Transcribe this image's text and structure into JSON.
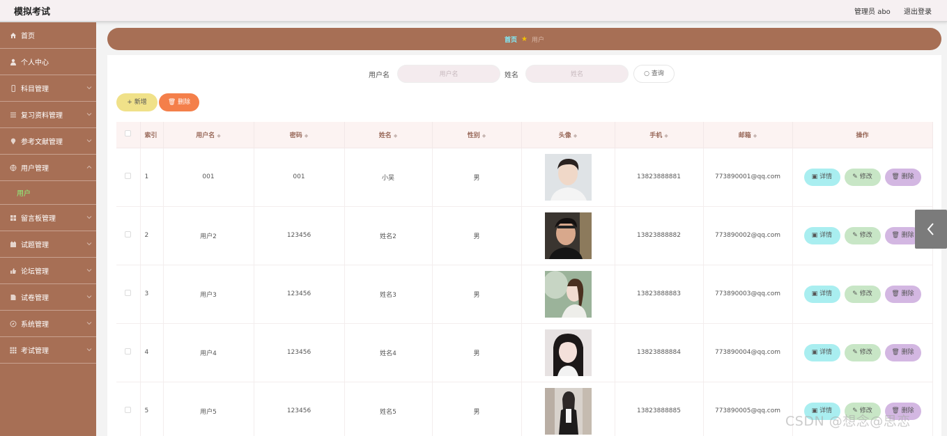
{
  "app": {
    "title": "模拟考试"
  },
  "header": {
    "user_label": "管理员 abo",
    "logout_label": "退出登录"
  },
  "sidebar": {
    "items": [
      {
        "label": "首页",
        "icon": "home-icon"
      },
      {
        "label": "个人中心",
        "icon": "user-icon"
      },
      {
        "label": "科目管理",
        "icon": "mobile-icon"
      },
      {
        "label": "复习资料管理",
        "icon": "list-icon"
      },
      {
        "label": "参考文献管理",
        "icon": "location-icon"
      },
      {
        "label": "用户管理",
        "icon": "globe-icon"
      },
      {
        "label": "留言板管理",
        "icon": "grid-icon"
      },
      {
        "label": "试题管理",
        "icon": "calendar-icon"
      },
      {
        "label": "论坛管理",
        "icon": "thumb-icon"
      },
      {
        "label": "试卷管理",
        "icon": "doc-icon"
      },
      {
        "label": "系统管理",
        "icon": "compass-icon"
      },
      {
        "label": "考试管理",
        "icon": "apps-icon"
      }
    ],
    "active_sub": "用户"
  },
  "breadcrumb": {
    "home": "首页",
    "current": "用户"
  },
  "search": {
    "username_label": "用户名",
    "username_placeholder": "用户名",
    "name_label": "姓名",
    "name_placeholder": "姓名",
    "query_button": "查询"
  },
  "actions": {
    "add": "新增",
    "delete": "删除"
  },
  "table": {
    "headers": {
      "index": "索引",
      "username": "用户名",
      "password": "密码",
      "name": "姓名",
      "gender": "性别",
      "avatar": "头像",
      "phone": "手机",
      "email": "邮箱",
      "ops": "操作"
    },
    "op_labels": {
      "detail": "详情",
      "edit": "修改",
      "delete": "删除"
    },
    "rows": [
      {
        "index": "1",
        "username": "001",
        "password": "001",
        "name": "小吴",
        "gender": "男",
        "phone": "13823888881",
        "email": "773890001@qq.com"
      },
      {
        "index": "2",
        "username": "用户2",
        "password": "123456",
        "name": "姓名2",
        "gender": "男",
        "phone": "13823888882",
        "email": "773890002@qq.com"
      },
      {
        "index": "3",
        "username": "用户3",
        "password": "123456",
        "name": "姓名3",
        "gender": "男",
        "phone": "13823888883",
        "email": "773890003@qq.com"
      },
      {
        "index": "4",
        "username": "用户4",
        "password": "123456",
        "name": "姓名4",
        "gender": "男",
        "phone": "13823888884",
        "email": "773890004@qq.com"
      },
      {
        "index": "5",
        "username": "用户5",
        "password": "123456",
        "name": "姓名5",
        "gender": "男",
        "phone": "13823888885",
        "email": "773890005@qq.com"
      }
    ]
  },
  "watermark": "CSDN @想念@思恋",
  "colors": {
    "sidebar": "#a76f55",
    "accent_cyan": "#7ff0ff",
    "active_sub": "#8ef57a"
  }
}
